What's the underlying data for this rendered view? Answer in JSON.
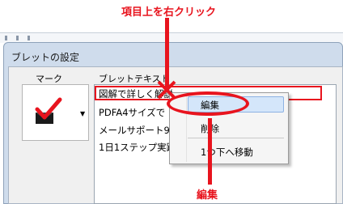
{
  "annotations": {
    "top": "項目上を右クリック",
    "bottom": "編集"
  },
  "dialog": {
    "title": "ブレットの設定",
    "mark_header": "マーク",
    "text_header": "ブレットテキスト",
    "mark_dropdown_glyph": "▼"
  },
  "bullet_list": {
    "items": [
      "図解で詳しく解説",
      "PDFA4サイズで",
      "メールサポート90日",
      "1日1ステップ実践"
    ]
  },
  "context_menu": {
    "items": [
      "編集",
      "削除",
      "1つ下へ移動"
    ]
  },
  "colors": {
    "annotation": "#e8141e",
    "menu_hover": "#d4e6fa"
  }
}
